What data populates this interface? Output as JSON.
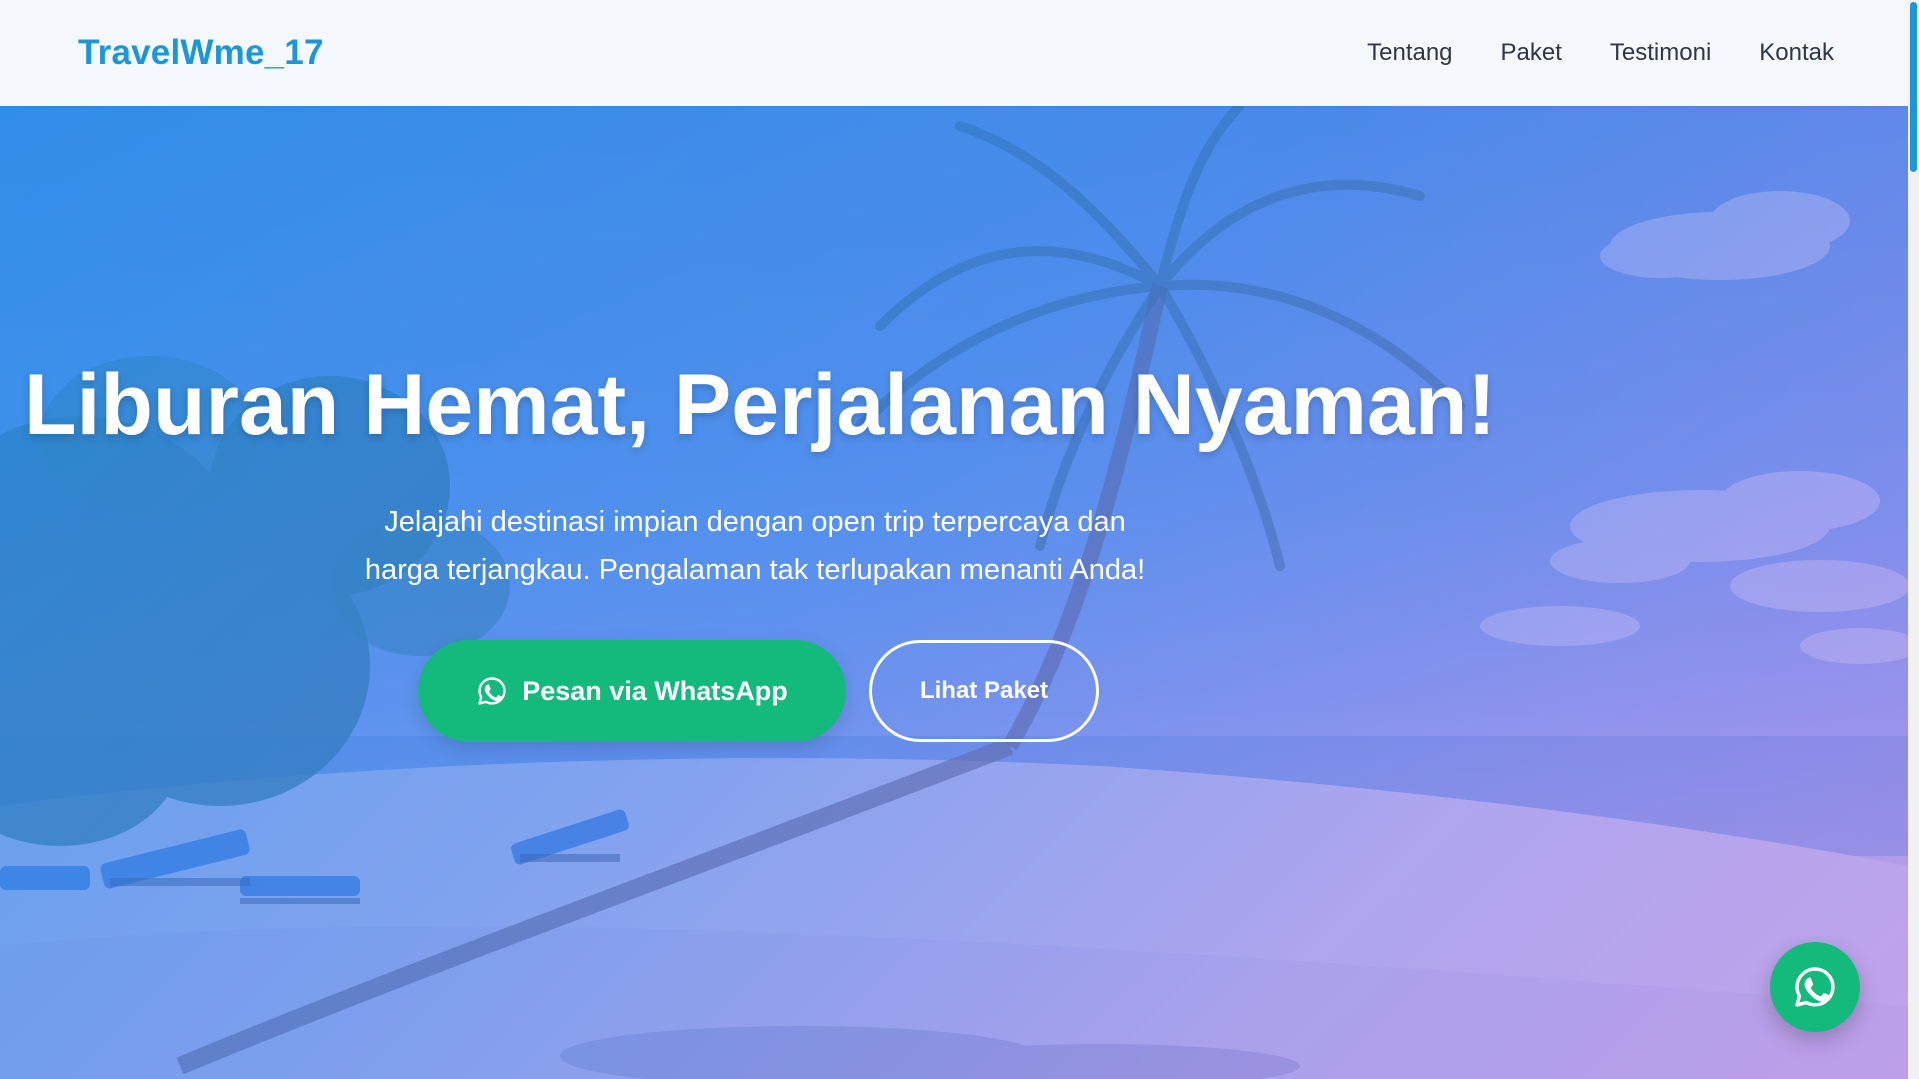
{
  "header": {
    "brand": "TravelWme_17",
    "nav": [
      "Tentang",
      "Paket",
      "Testimoni",
      "Kontak"
    ]
  },
  "hero": {
    "title": "Liburan Hemat, Perjalanan Nyaman!",
    "subtitle_line1": "Jelajahi destinasi impian dengan open trip terpercaya dan",
    "subtitle_line2": "harga terjangkau. Pengalaman tak terlupakan menanti Anda!",
    "primary_button": "Pesan via WhatsApp",
    "secondary_button": "Lihat Paket",
    "background": "tropical beach with palm trees and sun loungers"
  },
  "floating_button": {
    "icon": "whatsapp-icon"
  },
  "colors": {
    "brand": "#1b96d6",
    "whatsapp_green": "#14b97c",
    "overlay_blue": "#2587e8",
    "overlay_purple": "#a070e4",
    "header_bg": "#f5f8fc",
    "nav_text": "#2d3748"
  }
}
